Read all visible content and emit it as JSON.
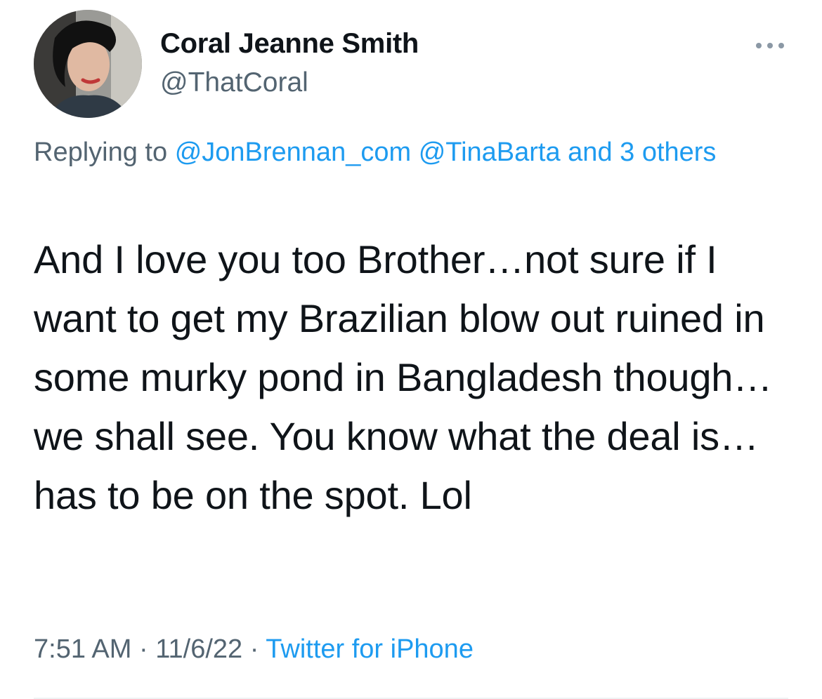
{
  "author": {
    "display_name": "Coral Jeanne Smith",
    "handle": "@ThatCoral",
    "avatar_icon": "profile-photo"
  },
  "more_icon": "more-horizontal-icon",
  "reply": {
    "prefix": "Replying to",
    "mentions": [
      "@JonBrennan_com",
      "@TinaBarta"
    ],
    "suffix": "and 3 others"
  },
  "tweet_text": "And I love you too Brother…not sure if I want to get my Brazilian blow out ruined in some murky pond in Bangladesh though…we shall see. You know what the deal is…has to be on the spot. Lol",
  "meta": {
    "time": "7:51 AM",
    "separator": "·",
    "date": "11/6/22",
    "source": "Twitter for iPhone"
  },
  "colors": {
    "text": "#0f1419",
    "secondary": "#536471",
    "link": "#1d9bf0",
    "divider": "#eff3f4"
  }
}
